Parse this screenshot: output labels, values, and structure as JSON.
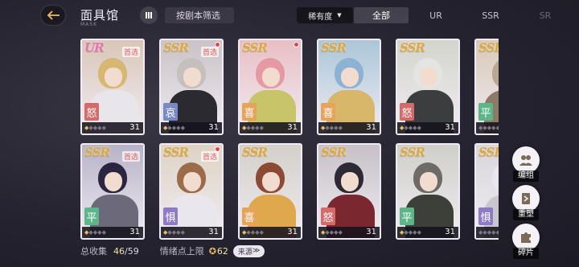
{
  "header": {
    "title": "面具馆",
    "subtitle": "MASK",
    "filter_label": "按剧本筛选",
    "sort_label": "稀有度",
    "sort_caret": "▼"
  },
  "tabs": [
    {
      "label": "全部",
      "active": true
    },
    {
      "label": "UR",
      "active": false
    },
    {
      "label": "SSR",
      "active": false
    },
    {
      "label": "SR",
      "active": false
    }
  ],
  "cards": [
    {
      "rarity": "UR",
      "preferred": "首选",
      "emotion": "怒",
      "level": "31",
      "stars": 1,
      "dot": false,
      "palette": {
        "bg": "#d9c6b8",
        "hair": "#d6b873",
        "body": "#e8e6ea",
        "tag": "#d56a6a"
      }
    },
    {
      "rarity": "SSR",
      "preferred": "首选",
      "emotion": "哀",
      "level": "31",
      "stars": 1,
      "dot": true,
      "palette": {
        "bg": "#c9c2c7",
        "hair": "#c5c0bd",
        "body": "#2b2a31",
        "tag": "#7b88c8"
      }
    },
    {
      "rarity": "SSR",
      "preferred": "",
      "emotion": "喜",
      "level": "31",
      "stars": 1,
      "dot": true,
      "palette": {
        "bg": "#e8bfc4",
        "hair": "#e59aa3",
        "body": "#c7c46a",
        "tag": "#e6a35a"
      }
    },
    {
      "rarity": "SSR",
      "preferred": "",
      "emotion": "喜",
      "level": "31",
      "stars": 1,
      "dot": false,
      "palette": {
        "bg": "#aac6d8",
        "hair": "#8db2d4",
        "body": "#d8b66a",
        "tag": "#e6a35a"
      }
    },
    {
      "rarity": "SSR",
      "preferred": "",
      "emotion": "怒",
      "level": "31",
      "stars": 1,
      "dot": false,
      "palette": {
        "bg": "#d3d5cc",
        "hair": "#e4e4e2",
        "body": "#3b3d3f",
        "tag": "#d56a6a"
      }
    },
    {
      "rarity": "SSR",
      "preferred": "",
      "emotion": "平",
      "level": "",
      "stars": 0,
      "dot": false,
      "palette": {
        "bg": "#d8c8b6",
        "hair": "#b8a892",
        "body": "#8c7a66",
        "tag": "#5db58a"
      }
    },
    {
      "rarity": "SSR",
      "preferred": "首选",
      "emotion": "平",
      "level": "31",
      "stars": 1,
      "dot": false,
      "palette": {
        "bg": "#b7b2c7",
        "hair": "#2b2540",
        "body": "#6c6a7a",
        "tag": "#5db58a"
      }
    },
    {
      "rarity": "SSR",
      "preferred": "首选",
      "emotion": "惧",
      "level": "31",
      "stars": 1,
      "dot": true,
      "palette": {
        "bg": "#ddd3c4",
        "hair": "#9c6c4a",
        "body": "#e9e6ee",
        "tag": "#8f7ac8"
      }
    },
    {
      "rarity": "SSR",
      "preferred": "",
      "emotion": "喜",
      "level": "31",
      "stars": 1,
      "dot": false,
      "palette": {
        "bg": "#d3cfc9",
        "hair": "#8c4a34",
        "body": "#e0a84c",
        "tag": "#e6a35a"
      }
    },
    {
      "rarity": "SSR",
      "preferred": "",
      "emotion": "怒",
      "level": "31",
      "stars": 1,
      "dot": false,
      "palette": {
        "bg": "#c7c0c8",
        "hair": "#2d2a36",
        "body": "#7a2730",
        "tag": "#d56a6a"
      }
    },
    {
      "rarity": "SSR",
      "preferred": "",
      "emotion": "平",
      "level": "31",
      "stars": 1,
      "dot": false,
      "palette": {
        "bg": "#cfcfc9",
        "hair": "#6d6a68",
        "body": "#3c4038",
        "tag": "#5db58a"
      }
    },
    {
      "rarity": "SSR",
      "preferred": "",
      "emotion": "惧",
      "level": "",
      "stars": 0,
      "dot": false,
      "palette": {
        "bg": "#d8d6dc",
        "hair": "#e8e6ee",
        "body": "#c9c6cf",
        "tag": "#8f7ac8"
      }
    }
  ],
  "side_buttons": [
    {
      "label": "编组",
      "icon": "group-icon"
    },
    {
      "label": "重塑",
      "icon": "reshape-icon"
    },
    {
      "label": "碎片",
      "icon": "puzzle-icon"
    }
  ],
  "footer": {
    "collection_label": "总收集",
    "collected": "46",
    "total": "/59",
    "emotion_cap_label": "情绪点上限",
    "emotion_cap_value": "62",
    "source_label": "来源",
    "source_arrow": "≫"
  },
  "colors": {
    "accent_gold": "#e8c060",
    "ur_pink": "#e07aa8",
    "ssr_gold": "#d9a94c"
  }
}
